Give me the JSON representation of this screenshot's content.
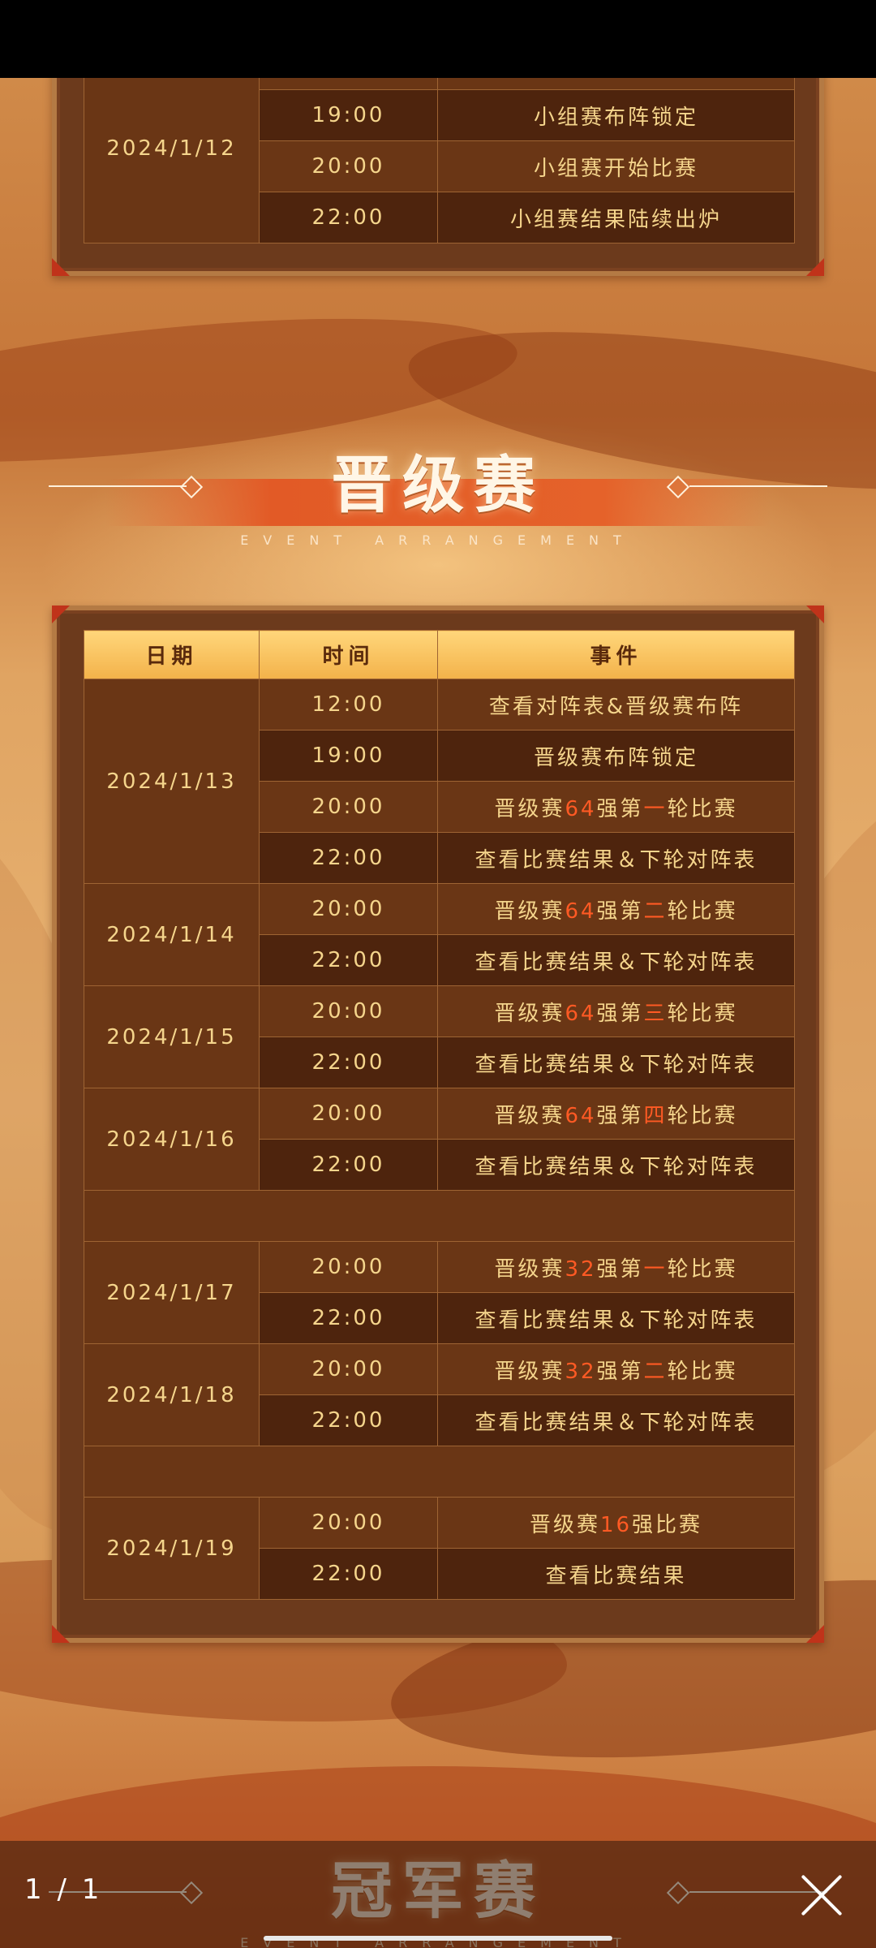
{
  "viewer": {
    "counter": "1 / 1"
  },
  "top_section": {
    "date": "2024/1/12",
    "rows": [
      {
        "time": "19:00",
        "event": "小组赛布阵锁定"
      },
      {
        "time": "20:00",
        "event": "小组赛开始比赛"
      },
      {
        "time": "22:00",
        "event": "小组赛结果陆续出炉"
      }
    ]
  },
  "section": {
    "title": "晋级赛",
    "subtitle": "EVENT ARRANGEMENT",
    "headers": {
      "date": "日期",
      "time": "时间",
      "event": "事件"
    }
  },
  "groups": [
    {
      "date": "2024/1/13",
      "rows": [
        {
          "time": "12:00",
          "parts": [
            [
              "查看对阵表&晋级赛布阵",
              false
            ]
          ]
        },
        {
          "time": "19:00",
          "parts": [
            [
              "晋级赛布阵锁定",
              false
            ]
          ]
        },
        {
          "time": "20:00",
          "parts": [
            [
              "晋级赛",
              false
            ],
            [
              "64",
              true
            ],
            [
              "强第",
              false
            ],
            [
              "一",
              true
            ],
            [
              "轮比赛",
              false
            ]
          ]
        },
        {
          "time": "22:00",
          "parts": [
            [
              "查看比赛结果＆下轮对阵表",
              false
            ]
          ]
        }
      ]
    },
    {
      "date": "2024/1/14",
      "rows": [
        {
          "time": "20:00",
          "parts": [
            [
              "晋级赛",
              false
            ],
            [
              "64",
              true
            ],
            [
              "强第",
              false
            ],
            [
              "二",
              true
            ],
            [
              "轮比赛",
              false
            ]
          ]
        },
        {
          "time": "22:00",
          "parts": [
            [
              "查看比赛结果＆下轮对阵表",
              false
            ]
          ]
        }
      ]
    },
    {
      "date": "2024/1/15",
      "rows": [
        {
          "time": "20:00",
          "parts": [
            [
              "晋级赛",
              false
            ],
            [
              "64",
              true
            ],
            [
              "强第",
              false
            ],
            [
              "三",
              true
            ],
            [
              "轮比赛",
              false
            ]
          ]
        },
        {
          "time": "22:00",
          "parts": [
            [
              "查看比赛结果＆下轮对阵表",
              false
            ]
          ]
        }
      ]
    },
    {
      "date": "2024/1/16",
      "rows": [
        {
          "time": "20:00",
          "parts": [
            [
              "晋级赛",
              false
            ],
            [
              "64",
              true
            ],
            [
              "强第",
              false
            ],
            [
              "四",
              true
            ],
            [
              "轮比赛",
              false
            ]
          ]
        },
        {
          "time": "22:00",
          "parts": [
            [
              "查看比赛结果＆下轮对阵表",
              false
            ]
          ]
        }
      ]
    },
    {
      "separator": true
    },
    {
      "date": "2024/1/17",
      "rows": [
        {
          "time": "20:00",
          "parts": [
            [
              "晋级赛",
              false
            ],
            [
              "32",
              true
            ],
            [
              "强第",
              false
            ],
            [
              "一",
              true
            ],
            [
              "轮比赛",
              false
            ]
          ]
        },
        {
          "time": "22:00",
          "parts": [
            [
              "查看比赛结果＆下轮对阵表",
              false
            ]
          ]
        }
      ]
    },
    {
      "date": "2024/1/18",
      "rows": [
        {
          "time": "20:00",
          "parts": [
            [
              "晋级赛",
              false
            ],
            [
              "32",
              true
            ],
            [
              "强第",
              false
            ],
            [
              "二",
              true
            ],
            [
              "轮比赛",
              false
            ]
          ]
        },
        {
          "time": "22:00",
          "parts": [
            [
              "查看比赛结果＆下轮对阵表",
              false
            ]
          ]
        }
      ]
    },
    {
      "separator": true
    },
    {
      "date": "2024/1/19",
      "rows": [
        {
          "time": "20:00",
          "parts": [
            [
              "晋级赛",
              false
            ],
            [
              "16",
              true
            ],
            [
              "强比赛",
              false
            ]
          ]
        },
        {
          "time": "22:00",
          "parts": [
            [
              "查看比赛结果",
              false
            ]
          ]
        }
      ]
    }
  ],
  "next_section": {
    "title": "冠军赛",
    "subtitle": "EVENT ARRANGEMENT"
  },
  "colors": {
    "highlight": "#ff5a24",
    "text": "#f5d58c",
    "header_bg": "#f3b24a"
  }
}
